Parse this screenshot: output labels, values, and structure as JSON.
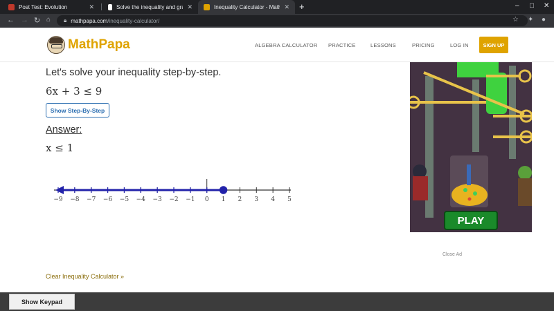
{
  "browser": {
    "tabs": [
      {
        "title": "Post Test: Evolution",
        "favicon_color": "#c0392b",
        "active": false
      },
      {
        "title": "Solve the inequality and graph t",
        "favicon_color": "#ffffff",
        "active": false
      },
      {
        "title": "Inequality Calculator - MathPap",
        "favicon_color": "#dfa300",
        "active": true
      }
    ],
    "new_tab_label": "+",
    "window_controls": [
      "–",
      "□",
      "✕"
    ],
    "url_domain": "mathpapa.com",
    "url_path": "/inequality-calculator/"
  },
  "site": {
    "logo_text": "MathPapa",
    "nav": [
      "ALGEBRA CALCULATOR",
      "PRACTICE",
      "LESSONS",
      "PRICING",
      "LOG IN"
    ],
    "signup_label": "SIGN UP",
    "accent": "#dfa300"
  },
  "content": {
    "intro": "Let's solve your inequality step-by-step.",
    "problem": "6x + 3 ≤ 9",
    "step_button": "Show Step-By-Step",
    "answer_label": "Answer:",
    "answer": "x ≤ 1",
    "number_line": {
      "min": -9,
      "max": 5,
      "ticks": [
        "−9",
        "−8",
        "−7",
        "−6",
        "−5",
        "−4",
        "−3",
        "−2",
        "−1",
        "0",
        "1",
        "2",
        "3",
        "4",
        "5"
      ],
      "endpoint": 1,
      "endpoint_closed": true,
      "direction": "left",
      "color": "#2222aa"
    },
    "clear_link": "Clear Inequality Calculator »"
  },
  "ad": {
    "button_label": "PLAY",
    "close_label": "Close Ad"
  },
  "footer": {
    "keypad_button": "Show Keypad"
  }
}
